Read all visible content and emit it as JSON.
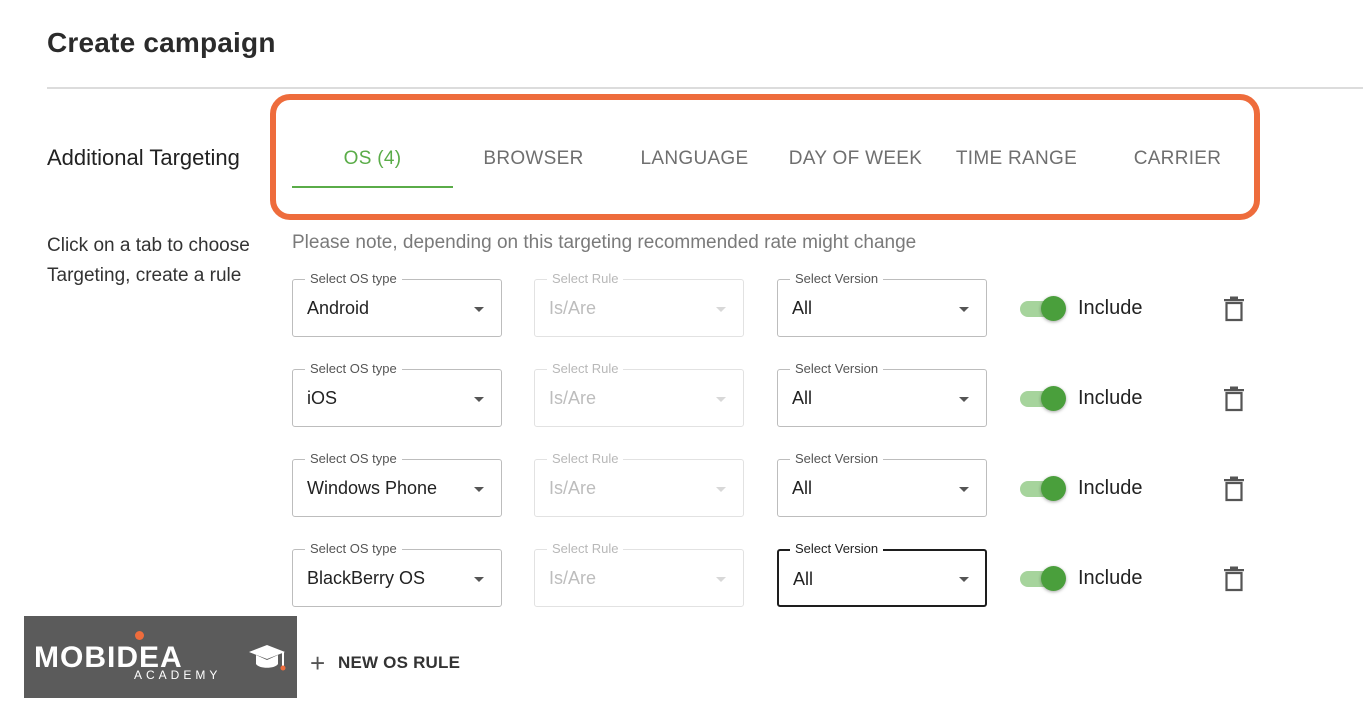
{
  "page": {
    "title": "Create campaign",
    "section_label": "Additional Targeting",
    "hint": "Click on a tab to choose Targeting, create a rule",
    "note": "Please note, depending on this targeting recommended rate might change"
  },
  "tabs": [
    {
      "label": "OS (4)",
      "active": true
    },
    {
      "label": "BROWSER",
      "active": false
    },
    {
      "label": "LANGUAGE",
      "active": false
    },
    {
      "label": "DAY OF WEEK",
      "active": false
    },
    {
      "label": "TIME RANGE",
      "active": false
    },
    {
      "label": "CARRIER",
      "active": false
    }
  ],
  "rules": [
    {
      "os_label": "Select OS type",
      "os_value": "Android",
      "rule_label": "Select Rule",
      "rule_value": "Is/Are",
      "version_label": "Select Version",
      "version_value": "All",
      "include_label": "Include",
      "include_on": true
    },
    {
      "os_label": "Select OS type",
      "os_value": "iOS",
      "rule_label": "Select Rule",
      "rule_value": "Is/Are",
      "version_label": "Select Version",
      "version_value": "All",
      "include_label": "Include",
      "include_on": true
    },
    {
      "os_label": "Select OS type",
      "os_value": "Windows Phone",
      "rule_label": "Select Rule",
      "rule_value": "Is/Are",
      "version_label": "Select Version",
      "version_value": "All",
      "include_label": "Include",
      "include_on": true
    },
    {
      "os_label": "Select OS type",
      "os_value": "BlackBerry OS",
      "rule_label": "Select Rule",
      "rule_value": "Is/Are",
      "version_label": "Select Version",
      "version_value": "All",
      "include_label": "Include",
      "include_on": true
    }
  ],
  "new_rule": {
    "label": "NEW OS RULE",
    "icon": "plus-icon"
  },
  "logo": {
    "brand": "MOBIDEA",
    "sub": "ACADEMY"
  },
  "colors": {
    "accent_green": "#5aac48",
    "highlight_orange": "#ee6c3c",
    "toggle_track": "#a6d49c",
    "toggle_knob": "#4a9f3c"
  }
}
